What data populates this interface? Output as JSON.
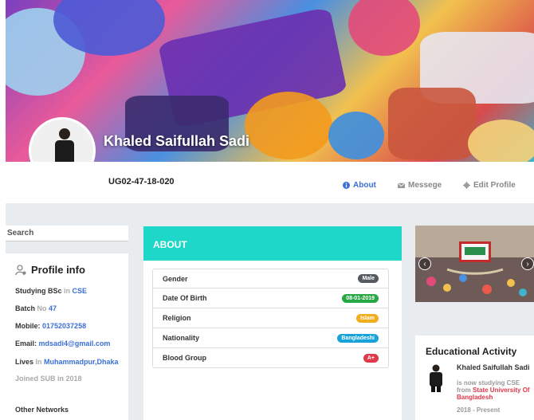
{
  "profile": {
    "name": "Khaled Saifullah Sadi",
    "student_id": "UG02-47-18-020"
  },
  "nav": {
    "about": "About",
    "message": "Messege",
    "edit_profile": "Edit Profile"
  },
  "search": {
    "label": "Search"
  },
  "profile_info": {
    "title": "Profile info",
    "studying_label": "Studying BSc",
    "studying_in": "in",
    "studying_dept": "CSE",
    "batch_label": "Batch",
    "batch_no": "No",
    "batch_value": "47",
    "mobile_label": "Mobile:",
    "mobile_value": "01752037258",
    "email_label": "Email:",
    "email_value": "mdsadi4@gmail.com",
    "lives_label": "Lives",
    "lives_in": "In",
    "lives_value": "Muhammadpur,Dhaka",
    "joined": "Joined SUB in 2018",
    "other_networks": "Other Networks"
  },
  "about": {
    "title": "ABOUT",
    "rows": [
      {
        "label": "Gender",
        "value": "Male",
        "color": "#555a60"
      },
      {
        "label": "Date Of Birth",
        "value": "08-01-2019",
        "color": "#28a745"
      },
      {
        "label": "Religion",
        "value": "Islam",
        "color": "#f0ad1e"
      },
      {
        "label": "Nationality",
        "value": "Bangladeshi",
        "color": "#17a2d8"
      },
      {
        "label": "Blood Group",
        "value": "A+",
        "color": "#e0394a"
      }
    ]
  },
  "education": {
    "title": "Educational Activity",
    "name": "Khaled Saifullah Sadi",
    "text_prefix": "is now studying CSE from",
    "institution": "State University Of Bangladesh",
    "years": "2018 - Present"
  },
  "colors": {
    "accent_teal": "#1fd7c9",
    "link_blue": "#3b6fd6",
    "highlight_red": "#e0394a"
  }
}
